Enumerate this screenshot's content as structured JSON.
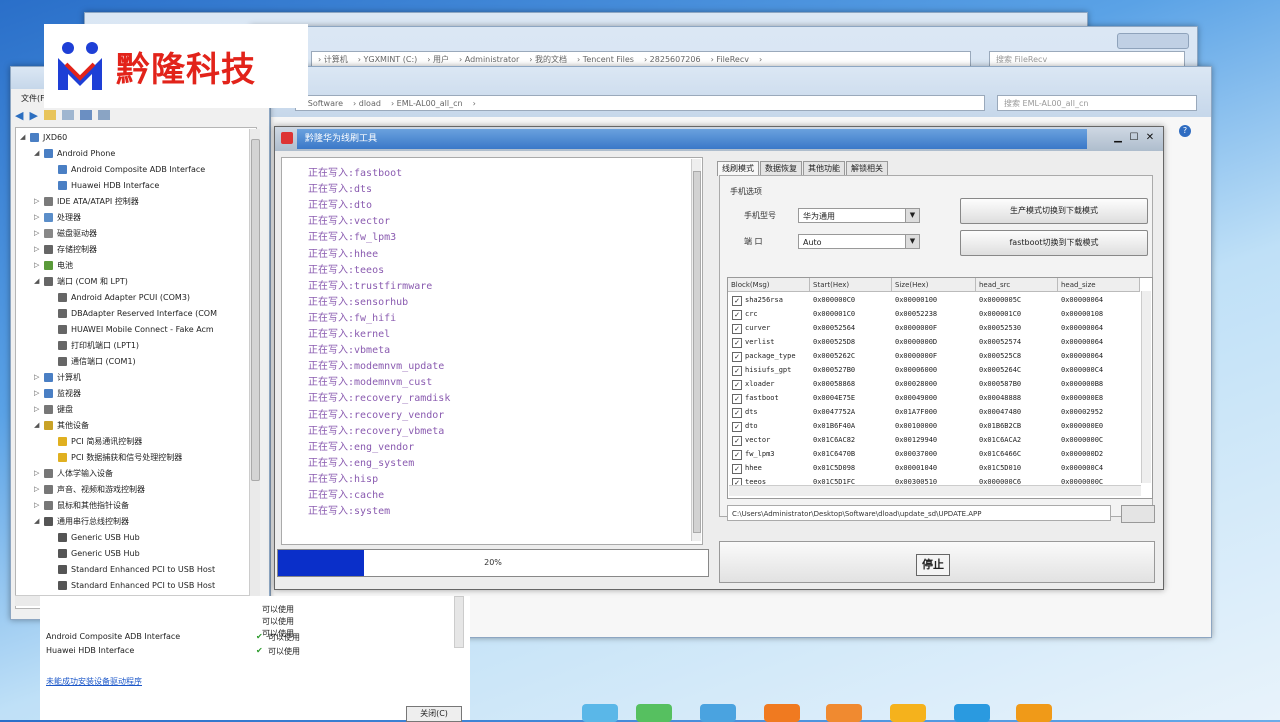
{
  "brand": {
    "name": "黔隆科技"
  },
  "back_window": {
    "address": [
      "› 计算机",
      "› YGXMINT (C:)",
      "› 用户",
      "› Administrator",
      "› 我的文档",
      "› Tencent Files",
      "› 2825607206",
      "› FileRecv",
      "›"
    ],
    "search_placeholder": "搜索 FileRecv"
  },
  "mid_window": {
    "address": [
      "› Software",
      "› dload",
      "› EML-AL00_all_cn",
      "›"
    ],
    "search_placeholder": "搜索 EML-AL00_all_cn"
  },
  "device_manager": {
    "menu": "文件(F)",
    "items": [
      {
        "label": "JXD60",
        "level": 0,
        "expander": "◢",
        "icon": "computer-icon",
        "color": "#4a7fc4"
      },
      {
        "label": "Android Phone",
        "level": 1,
        "expander": "◢",
        "icon": "phone-icon",
        "color": "#4a7fc4"
      },
      {
        "label": "Android Composite ADB Interface",
        "level": 2,
        "expander": "",
        "icon": "phone-icon",
        "color": "#4a7fc4"
      },
      {
        "label": "Huawei HDB Interface",
        "level": 2,
        "expander": "",
        "icon": "phone-icon",
        "color": "#4a7fc4"
      },
      {
        "label": "IDE ATA/ATAPI 控制器",
        "level": 1,
        "expander": "▷",
        "icon": "ide-controller-icon",
        "color": "#7a7a7a"
      },
      {
        "label": "处理器",
        "level": 1,
        "expander": "▷",
        "icon": "processor-icon",
        "color": "#5b8ec9"
      },
      {
        "label": "磁盘驱动器",
        "level": 1,
        "expander": "▷",
        "icon": "disk-drive-icon",
        "color": "#888"
      },
      {
        "label": "存储控制器",
        "level": 1,
        "expander": "▷",
        "icon": "storage-controller-icon",
        "color": "#666"
      },
      {
        "label": "电池",
        "level": 1,
        "expander": "▷",
        "icon": "battery-icon",
        "color": "#5a9a3a"
      },
      {
        "label": "端口 (COM 和 LPT)",
        "level": 1,
        "expander": "◢",
        "icon": "port-icon",
        "color": "#666"
      },
      {
        "label": "Android Adapter PCUI (COM3)",
        "level": 2,
        "expander": "",
        "icon": "port-icon",
        "color": "#666"
      },
      {
        "label": "DBAdapter Reserved Interface (COM",
        "level": 2,
        "expander": "",
        "icon": "port-icon",
        "color": "#666"
      },
      {
        "label": "HUAWEI Mobile Connect - Fake Acm",
        "level": 2,
        "expander": "",
        "icon": "port-icon",
        "color": "#666"
      },
      {
        "label": "打印机端口 (LPT1)",
        "level": 2,
        "expander": "",
        "icon": "port-icon",
        "color": "#666"
      },
      {
        "label": "通信端口 (COM1)",
        "level": 2,
        "expander": "",
        "icon": "port-icon",
        "color": "#666"
      },
      {
        "label": "计算机",
        "level": 1,
        "expander": "▷",
        "icon": "computer-icon",
        "color": "#4a7fc4"
      },
      {
        "label": "监视器",
        "level": 1,
        "expander": "▷",
        "icon": "monitor-icon",
        "color": "#4a7fc4"
      },
      {
        "label": "键盘",
        "level": 1,
        "expander": "▷",
        "icon": "keyboard-icon",
        "color": "#777"
      },
      {
        "label": "其他设备",
        "level": 1,
        "expander": "◢",
        "icon": "other-device-icon",
        "color": "#c9a227"
      },
      {
        "label": "PCI 简易通讯控制器",
        "level": 2,
        "expander": "",
        "icon": "warning-device-icon",
        "color": "#e0b020"
      },
      {
        "label": "PCI 数据捕获和信号处理控制器",
        "level": 2,
        "expander": "",
        "icon": "warning-device-icon",
        "color": "#e0b020"
      },
      {
        "label": "人体学输入设备",
        "level": 1,
        "expander": "▷",
        "icon": "hid-icon",
        "color": "#777"
      },
      {
        "label": "声音、视频和游戏控制器",
        "level": 1,
        "expander": "▷",
        "icon": "sound-icon",
        "color": "#777"
      },
      {
        "label": "鼠标和其他指针设备",
        "level": 1,
        "expander": "▷",
        "icon": "mouse-icon",
        "color": "#777"
      },
      {
        "label": "通用串行总线控制器",
        "level": 1,
        "expander": "◢",
        "icon": "usb-icon",
        "color": "#555"
      },
      {
        "label": "Generic USB Hub",
        "level": 2,
        "expander": "",
        "icon": "usb-icon",
        "color": "#555"
      },
      {
        "label": "Generic USB Hub",
        "level": 2,
        "expander": "",
        "icon": "usb-icon",
        "color": "#555"
      },
      {
        "label": "Standard Enhanced PCI to USB Host",
        "level": 2,
        "expander": "",
        "icon": "usb-icon",
        "color": "#555"
      },
      {
        "label": "Standard Enhanced PCI to USB Host",
        "level": 2,
        "expander": "",
        "icon": "usb-icon",
        "color": "#555"
      }
    ]
  },
  "properties_panel": {
    "rows": [
      {
        "name": "Android Composite ADB Interface",
        "status": "可以使用"
      },
      {
        "name": "Huawei HDB Interface",
        "status": "可以使用"
      }
    ],
    "extra_status": [
      "可以使用",
      "可以使用",
      "可以使用"
    ],
    "link": "未能成功安装设备驱动程序",
    "close_button": "关闭(C)"
  },
  "tool": {
    "title": "黔隆华为线刷工具",
    "log_lines": [
      "正在写入:fastboot",
      "正在写入:dts",
      "正在写入:dto",
      "正在写入:vector",
      "正在写入:fw_lpm3",
      "正在写入:hhee",
      "正在写入:teeos",
      "正在写入:trustfirmware",
      "正在写入:sensorhub",
      "正在写入:fw_hifi",
      "正在写入:kernel",
      "正在写入:vbmeta",
      "正在写入:modemnvm_update",
      "正在写入:modemnvm_cust",
      "正在写入:recovery_ramdisk",
      "正在写入:recovery_vendor",
      "正在写入:recovery_vbmeta",
      "正在写入:eng_vendor",
      "正在写入:eng_system",
      "正在写入:hisp",
      "正在写入:cache",
      "正在写入:system"
    ],
    "progress": {
      "value": 0.2,
      "label": "20%"
    },
    "tabs": [
      "线刷模式",
      "数据恢复",
      "其他功能",
      "解锁相关"
    ],
    "group_label": "手机选项",
    "model_label": "手机型号",
    "model_value": "华为通用",
    "port_label": "端  口",
    "port_value": "Auto",
    "btn_production": "生产模式切换到下载模式",
    "btn_fastboot": "fastboot切换到下载模式",
    "columns": [
      "Block(Msg)",
      "Start(Hex)",
      "Size(Hex)",
      "head_src",
      "head_size"
    ],
    "rows": [
      [
        "sha256rsa",
        "0x000000C0",
        "0x00000100",
        "0x0000005C",
        "0x00000064"
      ],
      [
        "crc",
        "0x000001C0",
        "0x00052238",
        "0x000001C0",
        "0x00000108"
      ],
      [
        "curver",
        "0x00052564",
        "0x0000000F",
        "0x00052530",
        "0x00000064"
      ],
      [
        "verlist",
        "0x000525D8",
        "0x0000000D",
        "0x00052574",
        "0x00000064"
      ],
      [
        "package_type",
        "0x0005262C",
        "0x0000000F",
        "0x000525C8",
        "0x00000064"
      ],
      [
        "hisiufs_gpt",
        "0x000527B0",
        "0x00006000",
        "0x0005264C",
        "0x000000C4"
      ],
      [
        "xloader",
        "0x00058868",
        "0x00028000",
        "0x000587B0",
        "0x000000B8"
      ],
      [
        "fastboot",
        "0x0004E75E",
        "0x00049000",
        "0x00048888",
        "0x000000E8"
      ],
      [
        "dts",
        "0x0047752A",
        "0x01A7F000",
        "0x00047480",
        "0x00002952"
      ],
      [
        "dto",
        "0x01B6F40A",
        "0x00100000",
        "0x01B6B2CB",
        "0x000000E0"
      ],
      [
        "vector",
        "0x01C6AC82",
        "0x00129940",
        "0x01C6ACA2",
        "0x0000000C"
      ],
      [
        "fw_lpm3",
        "0x01C6470B",
        "0x00037000",
        "0x01C6466C",
        "0x000000D2"
      ],
      [
        "hhee",
        "0x01C5D098",
        "0x00001040",
        "0x01C5D010",
        "0x000000C4"
      ],
      [
        "teeos",
        "0x01C5D1FC",
        "0x00300510",
        "0x000000C6",
        "0x0000000C"
      ]
    ],
    "path": "C:\\Users\\Administrator\\Desktop\\Software\\dload\\update_sd\\UPDATE.APP",
    "start_button": "停止"
  },
  "colors": {
    "accent": "#0a2fc9",
    "log_text": "#8a5bb0",
    "brand_red": "#e2231a",
    "brand_blue": "#1e3fd6"
  }
}
